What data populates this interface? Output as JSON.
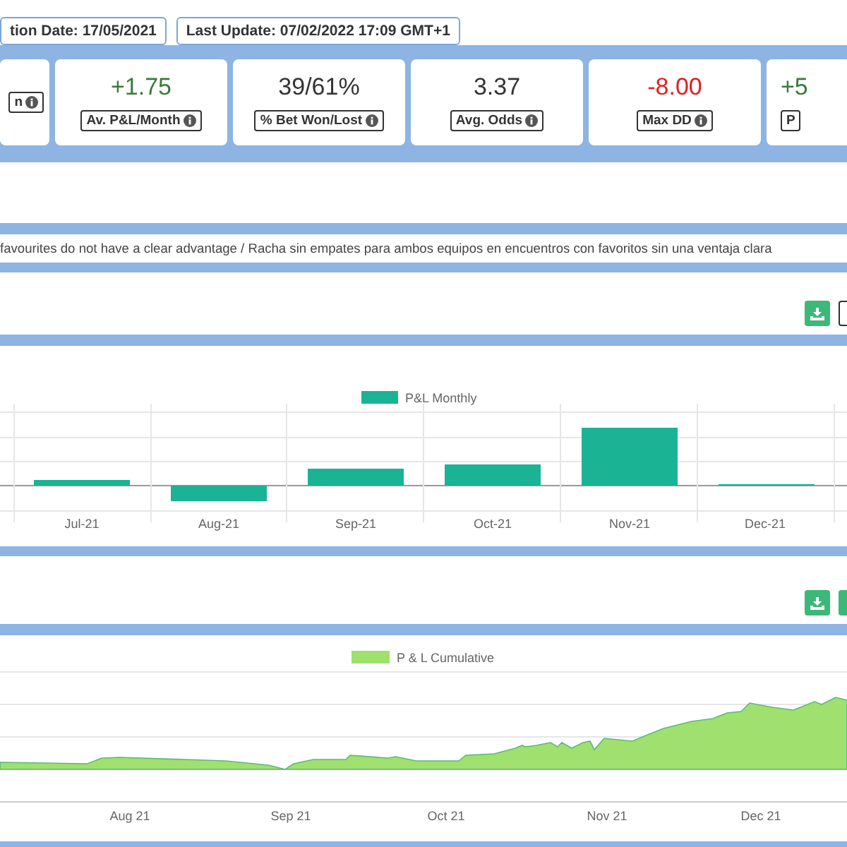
{
  "header": {
    "badges": [
      {
        "text": "tion Date: 17/05/2021"
      },
      {
        "text": "Last Update: 07/02/2022 17:09 GMT+1"
      }
    ]
  },
  "stats": [
    {
      "label": "n",
      "info": true
    },
    {
      "value": "+1.75",
      "label": "Av. P&L/Month",
      "color": "#3a7a3a",
      "info": true
    },
    {
      "value": "39/61%",
      "label": "% Bet Won/Lost",
      "color": "#333333",
      "info": true
    },
    {
      "value": "3.37",
      "label": "Avg. Odds",
      "color": "#333333",
      "info": true
    },
    {
      "value": "-8.00",
      "label": "Max DD",
      "color": "#e02020",
      "info": true
    },
    {
      "value": "+5",
      "label": "P",
      "color": "#3a7a3a",
      "info": false
    }
  ],
  "description": "favourites do not have a clear advantage / Racha sin empates para ambos equipos en encuentros con favoritos sin una ventaja clara",
  "monthly_toolbar": {
    "buttons": [
      {
        "kind": "download"
      },
      {
        "kind": "outline"
      }
    ]
  },
  "monthly_chart": {
    "legend": "P&L Monthly",
    "x_labels": [
      "Jul-21",
      "Aug-21",
      "Sep-21",
      "Oct-21",
      "Nov-21",
      "Dec-21"
    ]
  },
  "cumulative_toolbar": {
    "buttons": [
      {
        "kind": "download"
      },
      {
        "kind": "solid"
      }
    ]
  },
  "cumulative_chart": {
    "legend": "P & L Cumulative",
    "x_labels": [
      "Aug 21",
      "Sep 21",
      "Oct 21",
      "Nov 21",
      "Dec 21"
    ]
  }
}
